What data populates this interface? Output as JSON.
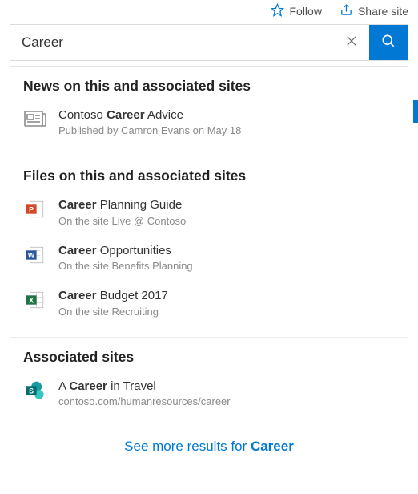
{
  "topbar": {
    "follow_label": "Follow",
    "share_label": "Share site"
  },
  "search": {
    "value": "Career",
    "placeholder": "Search"
  },
  "sections": {
    "news": {
      "heading": "News on this and associated sites",
      "items": [
        {
          "title_prefix": "Contoso ",
          "title_bold": "Career",
          "title_suffix": " Advice",
          "sub": "Published by Camron Evans on May 18"
        }
      ]
    },
    "files": {
      "heading": "Files on this and associated sites",
      "items": [
        {
          "title_bold": "Career",
          "title_suffix": " Planning Guide",
          "sub": "On the site Live @ Contoso",
          "icon": "powerpoint-icon"
        },
        {
          "title_bold": "Career",
          "title_suffix": " Opportunities",
          "sub": "On the site Benefits Planning",
          "icon": "word-icon"
        },
        {
          "title_bold": "Career",
          "title_suffix": " Budget 2017",
          "sub": "On the site Recruiting",
          "icon": "excel-icon"
        }
      ]
    },
    "sites": {
      "heading": "Associated sites",
      "items": [
        {
          "title_prefix": "A ",
          "title_bold": "Career",
          "title_suffix": " in Travel",
          "sub": "contoso.com/humanresources/career",
          "icon": "sharepoint-icon"
        }
      ]
    }
  },
  "seemore": {
    "prefix": "See more results for ",
    "term": "Career"
  },
  "icons": {
    "ppt_color": "#d24726",
    "word_color": "#2b579a",
    "excel_color": "#217346",
    "sharepoint_color": "#036c70"
  }
}
